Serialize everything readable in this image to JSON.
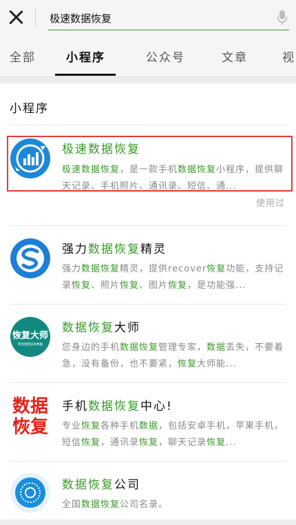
{
  "search": {
    "query": "极速数据恢复"
  },
  "tabs": [
    {
      "label": "全部"
    },
    {
      "label": "小程序"
    },
    {
      "label": "公众号"
    },
    {
      "label": "文章"
    },
    {
      "label": "视"
    }
  ],
  "section": {
    "title": "小程序"
  },
  "results": [
    {
      "title": [
        {
          "t": "极速数据恢复",
          "h": true
        }
      ],
      "desc": [
        {
          "t": "极速数据恢复",
          "h": true
        },
        {
          "t": "，是一款手机",
          "h": false
        },
        {
          "t": "数据恢复",
          "h": true
        },
        {
          "t": "小程序，提供聊天记录、手机照片、通讯录、短信、通...",
          "h": false
        }
      ],
      "icon": "data-recovery-chart-icon",
      "tag": "使用过"
    },
    {
      "title": [
        {
          "t": "强力",
          "h": false
        },
        {
          "t": "数据恢复",
          "h": true
        },
        {
          "t": "精灵",
          "h": false
        }
      ],
      "desc": [
        {
          "t": "强力",
          "h": false
        },
        {
          "t": "数据恢复",
          "h": true
        },
        {
          "t": "精灵，提供recover",
          "h": false
        },
        {
          "t": "恢复",
          "h": true
        },
        {
          "t": "功能，支持记录",
          "h": false
        },
        {
          "t": "恢复",
          "h": true
        },
        {
          "t": "、照片",
          "h": false
        },
        {
          "t": "恢复",
          "h": true
        },
        {
          "t": "、图片",
          "h": false
        },
        {
          "t": "恢复",
          "h": true
        },
        {
          "t": "，是功能强...",
          "h": false
        }
      ],
      "icon": "s-logo-icon"
    },
    {
      "title": [
        {
          "t": "数据恢复",
          "h": true
        },
        {
          "t": "大师",
          "h": false
        }
      ],
      "desc": [
        {
          "t": "您身边的手机",
          "h": false
        },
        {
          "t": "数据恢复",
          "h": true
        },
        {
          "t": "管理专家，",
          "h": false
        },
        {
          "t": "数据",
          "h": true
        },
        {
          "t": "丢失，不要着急，没有备份，也不要紧，",
          "h": false
        },
        {
          "t": "恢复",
          "h": true
        },
        {
          "t": "大师能...",
          "h": false
        }
      ],
      "icon": "recovery-master-icon",
      "icon_text": "恢复大师",
      "icon_sub": "帮您找回丢失数据"
    },
    {
      "title": [
        {
          "t": "手机",
          "h": false
        },
        {
          "t": "数据恢复",
          "h": true
        },
        {
          "t": "中心!",
          "h": false
        }
      ],
      "desc": [
        {
          "t": "专业",
          "h": false
        },
        {
          "t": "恢复",
          "h": true
        },
        {
          "t": "各种手机",
          "h": false
        },
        {
          "t": "数据",
          "h": true
        },
        {
          "t": "，包括安卓手机，苹果手机，短信",
          "h": false
        },
        {
          "t": "恢复",
          "h": true
        },
        {
          "t": "，通讯录",
          "h": false
        },
        {
          "t": "恢复",
          "h": true
        },
        {
          "t": "，聊天记录",
          "h": false
        },
        {
          "t": "恢复",
          "h": true
        },
        {
          "t": "...",
          "h": false
        }
      ],
      "icon": "red-text-logo-icon",
      "icon_text_top": "数据",
      "icon_text_bottom": "恢复"
    },
    {
      "title": [
        {
          "t": "数据恢复",
          "h": true
        },
        {
          "t": "公司",
          "h": false
        }
      ],
      "desc": [
        {
          "t": "全国",
          "h": false
        },
        {
          "t": "数据恢复",
          "h": true
        },
        {
          "t": "公司名录。",
          "h": false
        }
      ],
      "icon": "blue-circle-icon"
    }
  ],
  "colors": {
    "highlight": "#3a9a2a",
    "annotation_box": "#e53935",
    "text_gray": "#888888"
  }
}
